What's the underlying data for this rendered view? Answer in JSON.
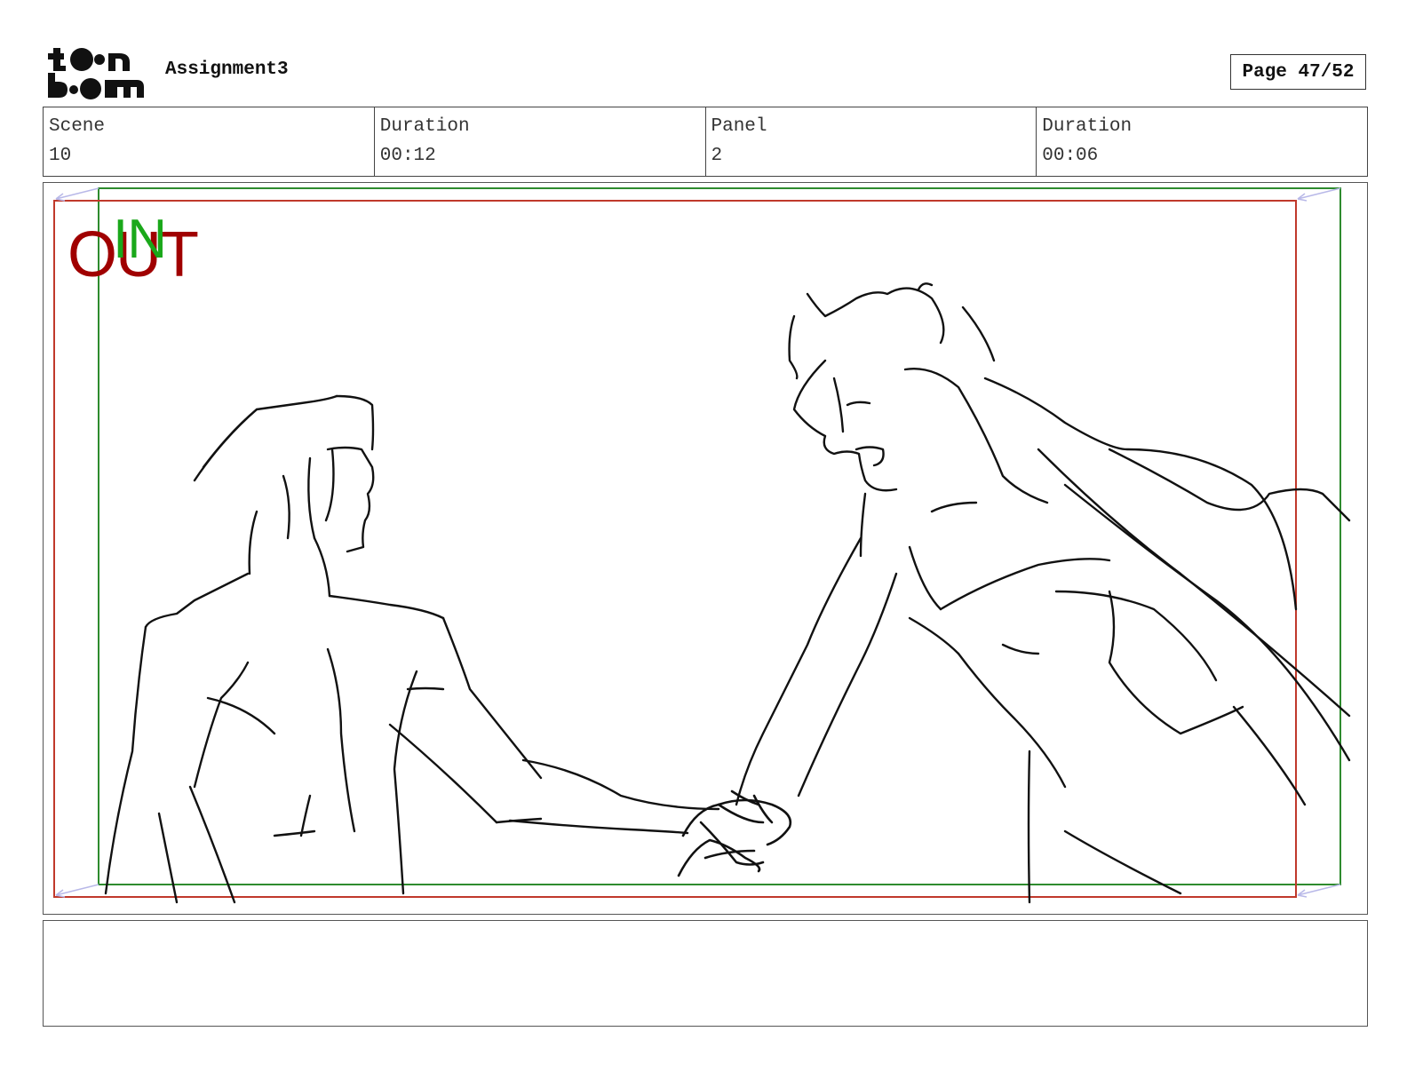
{
  "header": {
    "logo_text": "toon boom",
    "project_title": "Assignment3",
    "page_label": "Page 47/52"
  },
  "info": [
    {
      "label": "Scene",
      "value": "10"
    },
    {
      "label": "Duration",
      "value": "00:12"
    },
    {
      "label": "Panel",
      "value": "2"
    },
    {
      "label": "Duration",
      "value": "00:06"
    }
  ],
  "panel": {
    "out_label": "OUT",
    "in_label": "IN",
    "out_frame_color": "#c0392b",
    "in_frame_color": "#2e8b2e",
    "sketch_description_icon": "sketch-drawing"
  },
  "notes": {
    "text": ""
  }
}
